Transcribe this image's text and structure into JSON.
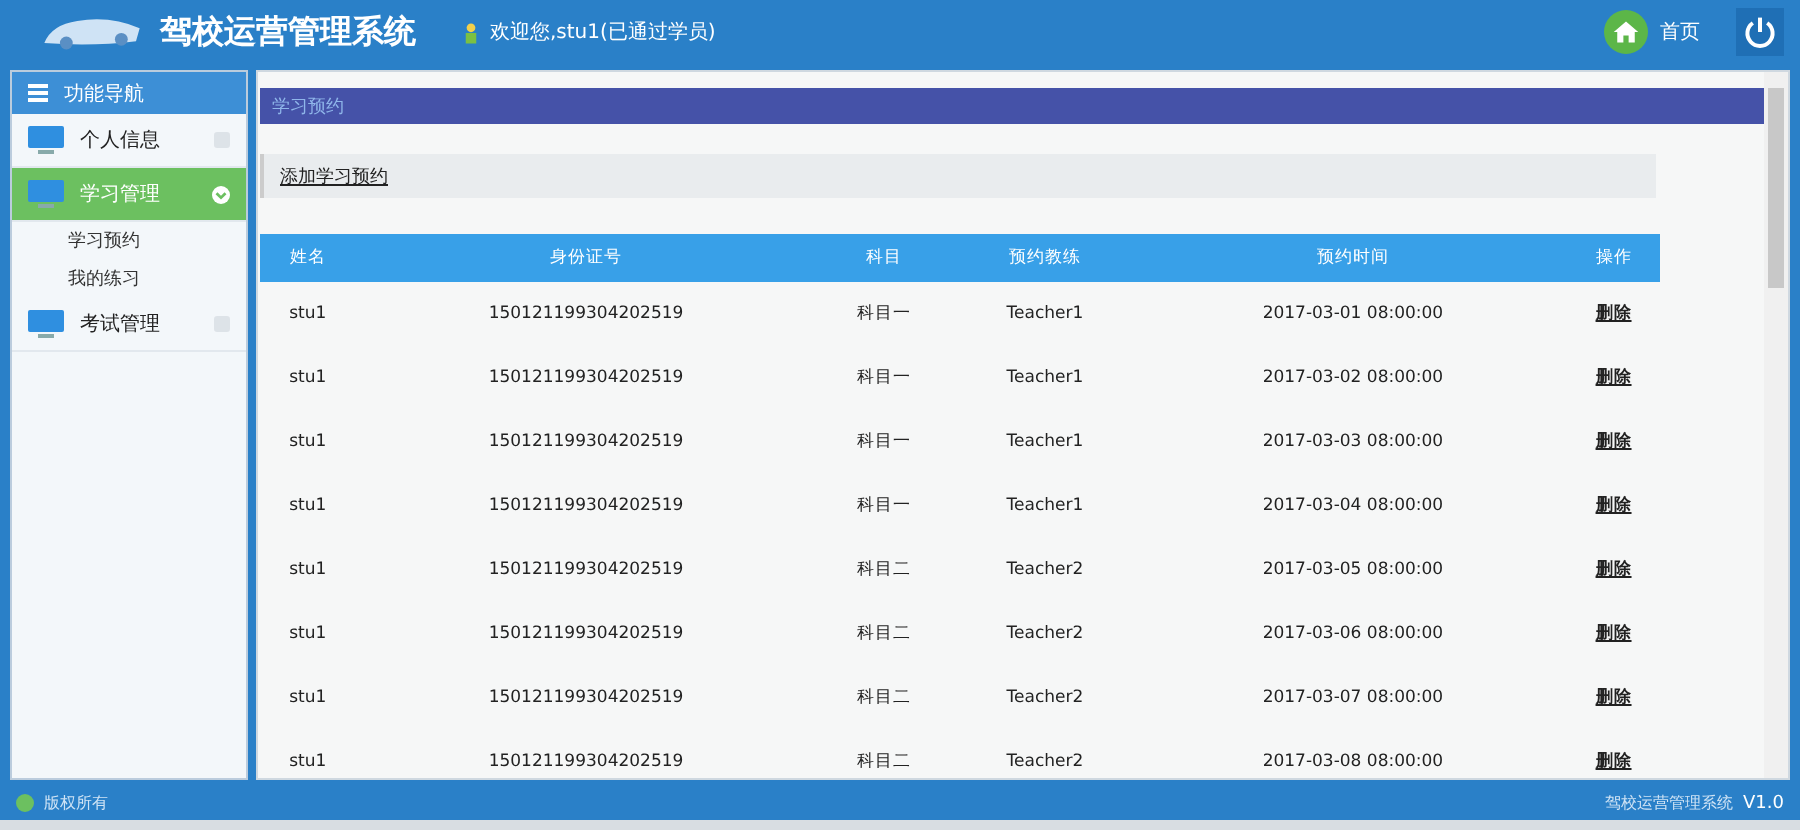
{
  "header": {
    "title": "驾校运营管理系统",
    "welcome": "欢迎您,stu1(已通过学员)",
    "home_label": "首页"
  },
  "sidebar": {
    "title": "功能导航",
    "items": [
      {
        "label": "个人信息",
        "expanded": false,
        "selected": false
      },
      {
        "label": "学习管理",
        "expanded": true,
        "selected": true,
        "children": [
          {
            "label": "学习预约"
          },
          {
            "label": "我的练习"
          }
        ]
      },
      {
        "label": "考试管理",
        "expanded": false,
        "selected": false
      }
    ]
  },
  "panel": {
    "title": "学习预约",
    "action": "添加学习预约"
  },
  "table": {
    "columns": [
      "姓名",
      "身份证号",
      "科目",
      "预约教练",
      "预约时间",
      "操作"
    ],
    "rows": [
      [
        "stu1",
        "150121199304202519",
        "科目一",
        "Teacher1",
        "2017-03-01 08:00:00",
        "删除"
      ],
      [
        "stu1",
        "150121199304202519",
        "科目一",
        "Teacher1",
        "2017-03-02 08:00:00",
        "删除"
      ],
      [
        "stu1",
        "150121199304202519",
        "科目一",
        "Teacher1",
        "2017-03-03 08:00:00",
        "删除"
      ],
      [
        "stu1",
        "150121199304202519",
        "科目一",
        "Teacher1",
        "2017-03-04 08:00:00",
        "删除"
      ],
      [
        "stu1",
        "150121199304202519",
        "科目二",
        "Teacher2",
        "2017-03-05 08:00:00",
        "删除"
      ],
      [
        "stu1",
        "150121199304202519",
        "科目二",
        "Teacher2",
        "2017-03-06 08:00:00",
        "删除"
      ],
      [
        "stu1",
        "150121199304202519",
        "科目二",
        "Teacher2",
        "2017-03-07 08:00:00",
        "删除"
      ],
      [
        "stu1",
        "150121199304202519",
        "科目二",
        "Teacher2",
        "2017-03-08 08:00:00",
        "删除"
      ]
    ]
  },
  "status_bar": {
    "left": "版权所有",
    "right": "驾校运营管理系统",
    "version": "V1.0"
  }
}
